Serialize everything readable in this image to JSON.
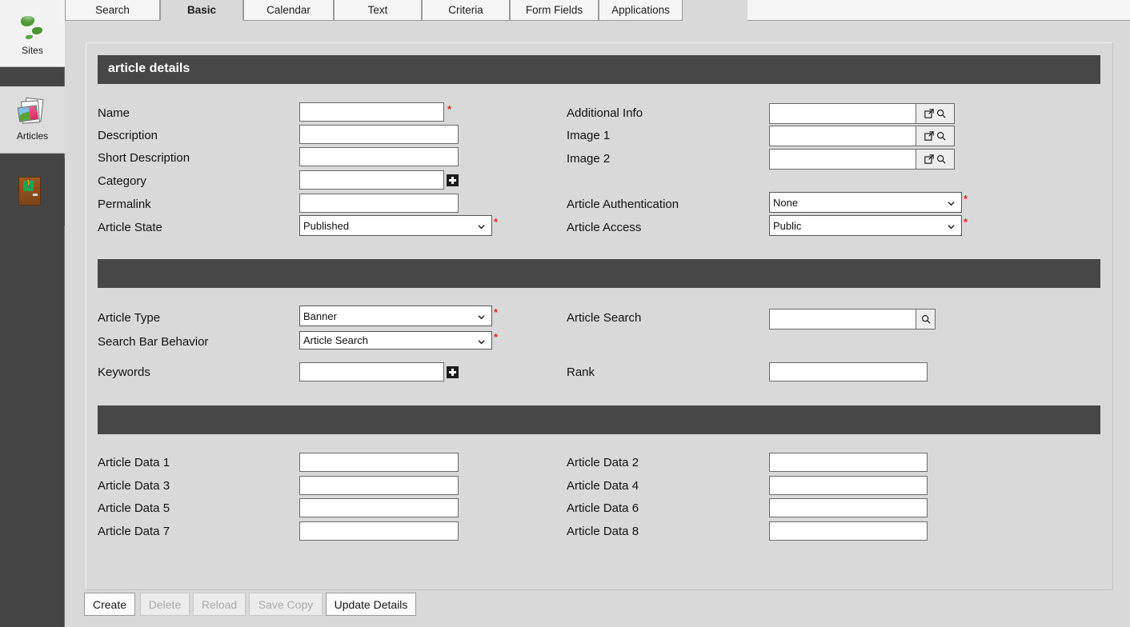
{
  "sidebar": {
    "items": [
      {
        "label": "Sites",
        "icon": "globe-icon"
      },
      {
        "label": "Articles",
        "icon": "articles-icon"
      },
      {
        "label": "",
        "icon": "exit-door-icon"
      }
    ]
  },
  "tabs": [
    {
      "label": "Search",
      "active": false
    },
    {
      "label": "Basic",
      "active": true
    },
    {
      "label": "Calendar",
      "active": false
    },
    {
      "label": "Text",
      "active": false
    },
    {
      "label": "Criteria",
      "active": false
    },
    {
      "label": "Form Fields",
      "active": false
    },
    {
      "label": "Applications",
      "active": false
    }
  ],
  "panel": {
    "section1_title": "article details",
    "section2_title": "",
    "section3_title": ""
  },
  "fields": {
    "name": {
      "label": "Name",
      "value": "",
      "required": true
    },
    "description": {
      "label": "Description",
      "value": ""
    },
    "short_desc": {
      "label": "Short Description",
      "value": ""
    },
    "category": {
      "label": "Category",
      "value": ""
    },
    "permalink": {
      "label": "Permalink",
      "value": ""
    },
    "state": {
      "label": "Article State",
      "value": "Published",
      "required": true
    },
    "additional": {
      "label": "Additional Info",
      "value": ""
    },
    "image1": {
      "label": "Image 1",
      "value": ""
    },
    "image2": {
      "label": "Image 2",
      "value": ""
    },
    "auth": {
      "label": "Article Authentication",
      "value": "None",
      "required": true
    },
    "access": {
      "label": "Article Access",
      "value": "Public",
      "required": true
    },
    "type": {
      "label": "Article Type",
      "value": "Banner",
      "required": true
    },
    "searchbar": {
      "label": "Search Bar Behavior",
      "value": "Article Search",
      "required": true
    },
    "keywords": {
      "label": "Keywords",
      "value": ""
    },
    "artsearch": {
      "label": "Article Search",
      "value": ""
    },
    "rank": {
      "label": "Rank",
      "value": ""
    },
    "data1": {
      "label": "Article Data 1",
      "value": ""
    },
    "data2": {
      "label": "Article Data 2",
      "value": ""
    },
    "data3": {
      "label": "Article Data 3",
      "value": ""
    },
    "data4": {
      "label": "Article Data 4",
      "value": ""
    },
    "data5": {
      "label": "Article Data 5",
      "value": ""
    },
    "data6": {
      "label": "Article Data 6",
      "value": ""
    },
    "data7": {
      "label": "Article Data 7",
      "value": ""
    },
    "data8": {
      "label": "Article Data 8",
      "value": ""
    }
  },
  "icons": {
    "popup": "open-external-icon",
    "search": "search-icon",
    "plus": "add-icon"
  },
  "buttons": [
    {
      "label": "Create",
      "enabled": true
    },
    {
      "label": "Delete",
      "enabled": false
    },
    {
      "label": "Reload",
      "enabled": false
    },
    {
      "label": "Save Copy",
      "enabled": false
    },
    {
      "label": "Update Details",
      "enabled": true
    }
  ],
  "colors": {
    "section_bar": "#474747",
    "page_bg": "#d9d9d9",
    "sidebar_bg": "#454545",
    "required_star": "#e8262a"
  }
}
